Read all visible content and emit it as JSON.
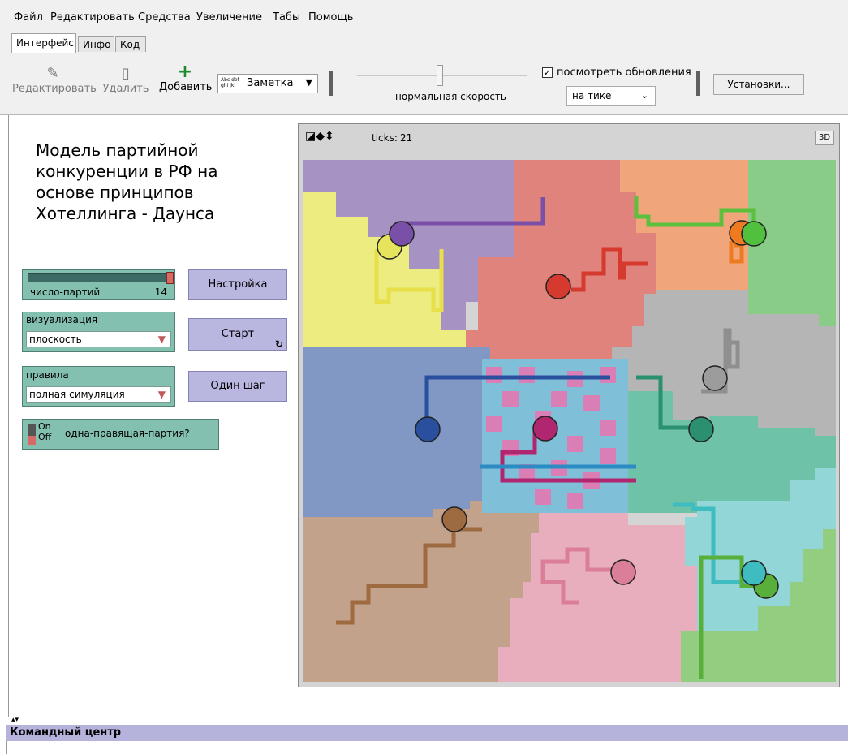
{
  "menu": [
    "Файл",
    "Редактировать",
    "Средства",
    "Увеличение",
    "Табы",
    "Помощь"
  ],
  "tabs": [
    "Интерфейс",
    "Инфо",
    "Код"
  ],
  "toolbar": {
    "edit_label": "Редактировать",
    "delete_label": "Удалить",
    "add_label": "Добавить",
    "widget_type": "Заметка",
    "widget_type_icon_text": "Abc def ghi jkl",
    "speed_label": "нормальная скорость",
    "view_updates_label": "посмотреть обновления",
    "view_updates_checked": true,
    "update_mode": "на тике",
    "settings_label": "Установки..."
  },
  "model": {
    "title": "Модель партийной конкуренции в РФ на основе принципов Хотеллинга - Даунса"
  },
  "widgets": {
    "slider": {
      "name": "число-партий",
      "value": "14",
      "fill_fraction": 1.0
    },
    "setup_button": "Настройка",
    "visualization_chooser": {
      "label": "визуализация",
      "value": "плоскость"
    },
    "start_button": "Старт",
    "rules_chooser": {
      "label": "правила",
      "value": "полная симуляция"
    },
    "step_button": "Один шаг",
    "switch": {
      "on_label": "On",
      "off_label": "Off",
      "name": "одна-правящая-партия?",
      "state": "off"
    }
  },
  "view": {
    "ticks_label": "ticks:",
    "ticks_value": "21",
    "three_d_label": "3D"
  },
  "command_center": {
    "title": "Командный центр"
  },
  "colors": {
    "purple": "#a693c4",
    "salmon": "#e0837c",
    "orange": "#f0a57a",
    "green": "#88cc88",
    "yellow": "#ecec80",
    "gray": "#b5b5b5",
    "blue": "#8197c4",
    "mix_cyan": "#7fbfd8",
    "mix_pink": "#d97fb5",
    "teal": "#6dc2a8",
    "cyan": "#93d6d8",
    "brown": "#c3a28b",
    "pink": "#e9aebd",
    "lightgreen": "#93cd7f"
  }
}
